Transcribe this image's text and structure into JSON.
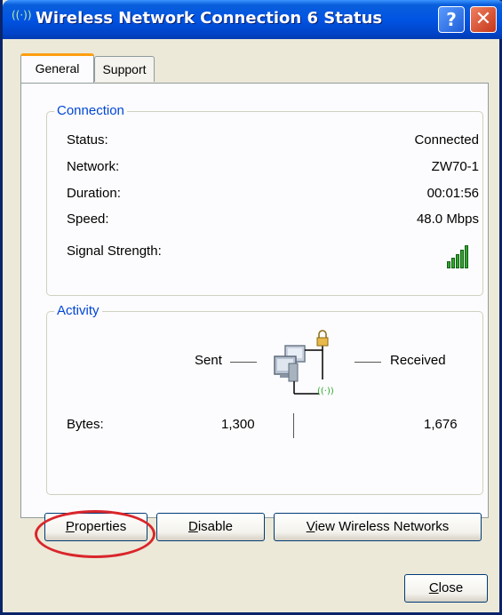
{
  "window": {
    "title": "Wireless Network Connection 6 Status",
    "help_glyph": "?",
    "close_glyph": "✕",
    "title_icon_glyph": "((·))"
  },
  "tabs": [
    {
      "label": "General",
      "active": true
    },
    {
      "label": "Support",
      "active": false
    }
  ],
  "connection": {
    "legend": "Connection",
    "rows": [
      {
        "label": "Status:",
        "value": "Connected"
      },
      {
        "label": "Network:",
        "value": "ZW70-1"
      },
      {
        "label": "Duration:",
        "value": "00:01:56"
      },
      {
        "label": "Speed:",
        "value": "48.0 Mbps"
      },
      {
        "label": "Signal Strength:",
        "value": ""
      }
    ],
    "signal_bars_lit": 5,
    "signal_bars_total": 5
  },
  "activity": {
    "legend": "Activity",
    "sent_label": "Sent",
    "received_label": "Received",
    "bytes_label": "Bytes:",
    "bytes_sent": "1,300",
    "bytes_received": "1,676",
    "icon_badge": "((·))"
  },
  "buttons": {
    "properties": {
      "first": "P",
      "rest": "roperties"
    },
    "disable": {
      "first": "D",
      "rest": "isable"
    },
    "view_wireless": {
      "first": "V",
      "rest": "iew Wireless Networks"
    },
    "close": {
      "first": "C",
      "rest": "lose"
    }
  },
  "colors": {
    "titlebar": "#0054e3",
    "group_legend": "#0046d5",
    "highlight_ellipse": "#d9262b",
    "signal_bar": "#2fa62f"
  }
}
